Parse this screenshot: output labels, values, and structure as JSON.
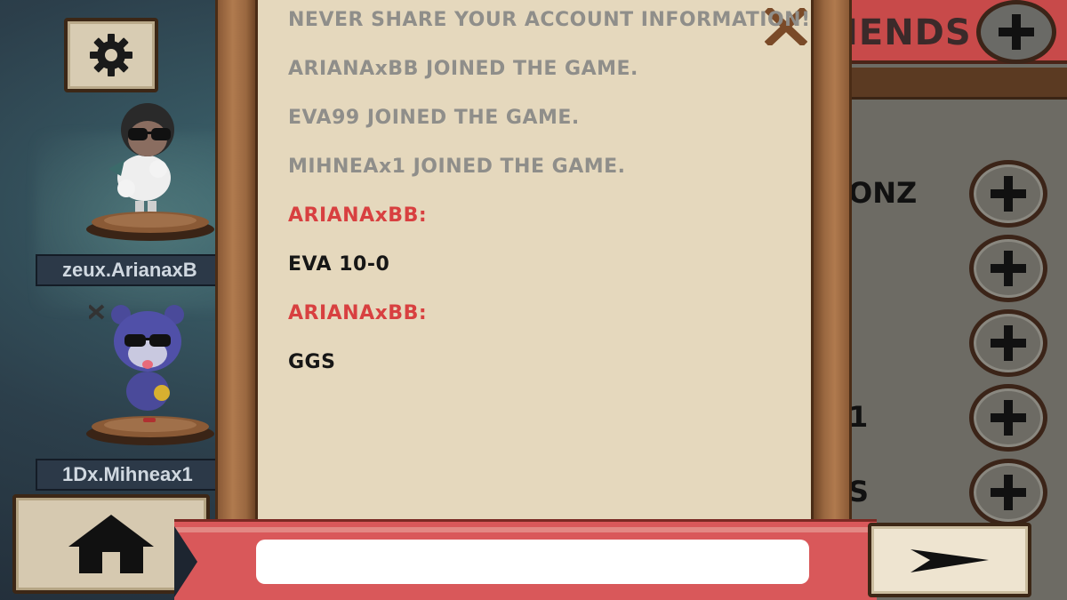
{
  "players": [
    {
      "name": "zeux.ArianaxB"
    },
    {
      "name": "1Dx.Mihneax1"
    }
  ],
  "friends": {
    "title": "IENDS",
    "rows": [
      {
        "name": "ONZ"
      },
      {
        "name": ""
      },
      {
        "name": ""
      },
      {
        "name": "1"
      },
      {
        "name": "S"
      }
    ]
  },
  "chat": {
    "messages": [
      {
        "type": "system",
        "text": "NEVER SHARE YOUR ACCOUNT INFORMATION!"
      },
      {
        "type": "system",
        "text": "ARIANAxBB  JOINED THE GAME."
      },
      {
        "type": "system",
        "text": "EVA99  JOINED THE GAME."
      },
      {
        "type": "system",
        "text": "MIHNEAx1  JOINED THE GAME."
      },
      {
        "type": "sender",
        "text": "ARIANAxBB:"
      },
      {
        "type": "msg",
        "text": "EVA 10-0"
      },
      {
        "type": "sender",
        "text": "ARIANAxBB:"
      },
      {
        "type": "msg",
        "text": "GGS"
      }
    ],
    "input": {
      "value": "",
      "placeholder": ""
    }
  },
  "icons": {
    "settings": "gear-icon",
    "home": "home-icon",
    "send": "send-arrow-icon",
    "close": "close-icon",
    "add": "plus-icon"
  },
  "colors": {
    "system_text": "#8f8e8a",
    "sender_text": "#d84040",
    "message_text": "#161616",
    "ribbon": "#d9585a",
    "parchment": "#e5d8bd"
  }
}
